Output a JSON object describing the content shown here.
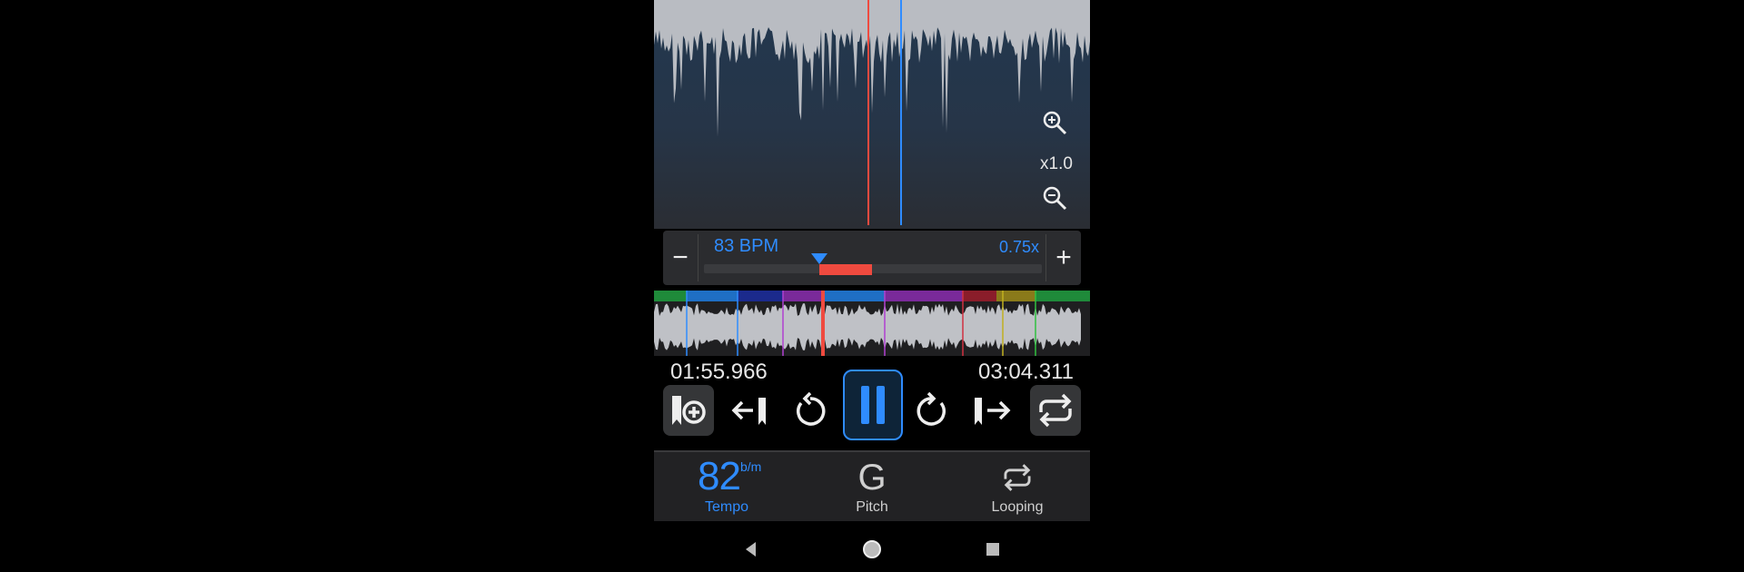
{
  "zoom": {
    "in_icon": "zoom-in-icon",
    "out_icon": "zoom-out-icon",
    "level": "x1.0"
  },
  "tempo_bar": {
    "bpm_label": "83 BPM",
    "speed_label": "0.75x",
    "minus_label": "−",
    "plus_label": "+"
  },
  "playback": {
    "elapsed": "01:55.966",
    "total": "03:04.311"
  },
  "controls": [
    {
      "name": "add-marker-button",
      "icon": "bookmark-add-icon"
    },
    {
      "name": "previous-marker-button",
      "icon": "jump-back-marker-icon"
    },
    {
      "name": "rewind-button",
      "icon": "rewind-icon"
    },
    {
      "name": "pause-button",
      "icon": "pause-icon"
    },
    {
      "name": "forward-button",
      "icon": "forward-icon"
    },
    {
      "name": "next-marker-button",
      "icon": "jump-forward-marker-icon"
    },
    {
      "name": "loop-toggle-button",
      "icon": "repeat-icon"
    }
  ],
  "tabs": {
    "tempo": {
      "value": "82",
      "unit": "b/m",
      "label": "Tempo"
    },
    "pitch": {
      "value": "G",
      "label": "Pitch"
    },
    "looping": {
      "icon": "repeat-icon",
      "label": "Looping"
    }
  },
  "navbar": {
    "back": "back-triangle-icon",
    "home": "home-circle-icon",
    "recents": "recents-square-icon"
  },
  "colors": {
    "accent": "#2f8cff",
    "playhead": "#ef4a3f",
    "segments": [
      "#1f8a3a",
      "#1f6fc4",
      "#1b2a8c",
      "#7a2a9a",
      "#1f6fc4",
      "#7a2a9a",
      "#8a1d2a",
      "#8a7a1a",
      "#1f8a3a"
    ]
  }
}
